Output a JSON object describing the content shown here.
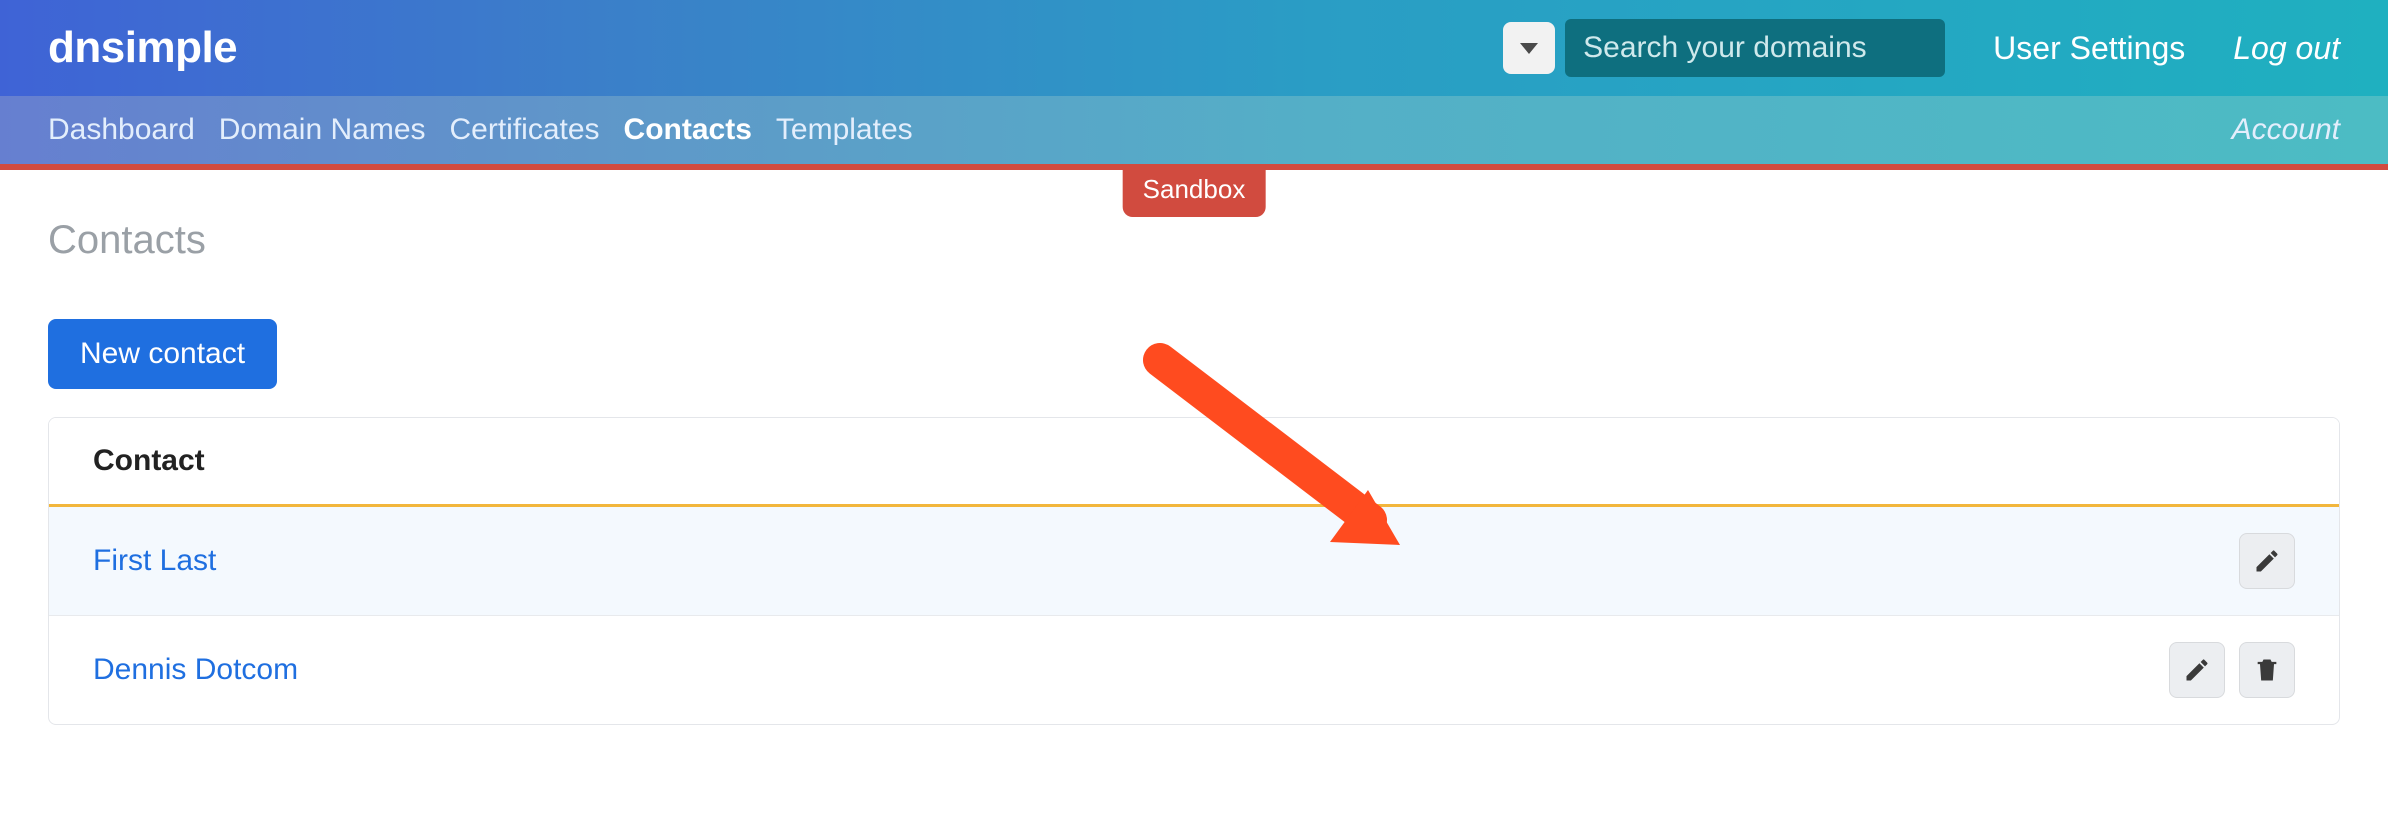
{
  "header": {
    "brand": "dnsimple",
    "search_placeholder": "Search your domains",
    "user_settings": "User Settings",
    "log_out": "Log out"
  },
  "nav": {
    "items": [
      {
        "label": "Dashboard",
        "active": false
      },
      {
        "label": "Domain Names",
        "active": false
      },
      {
        "label": "Certificates",
        "active": false
      },
      {
        "label": "Contacts",
        "active": true
      },
      {
        "label": "Templates",
        "active": false
      }
    ],
    "account": "Account"
  },
  "sandbox_label": "Sandbox",
  "page": {
    "title": "Contacts",
    "new_contact": "New contact",
    "col_header": "Contact",
    "rows": [
      {
        "name": "First Last",
        "highlight": true,
        "can_delete": false
      },
      {
        "name": "Dennis Dotcom",
        "highlight": false,
        "can_delete": true
      }
    ]
  }
}
